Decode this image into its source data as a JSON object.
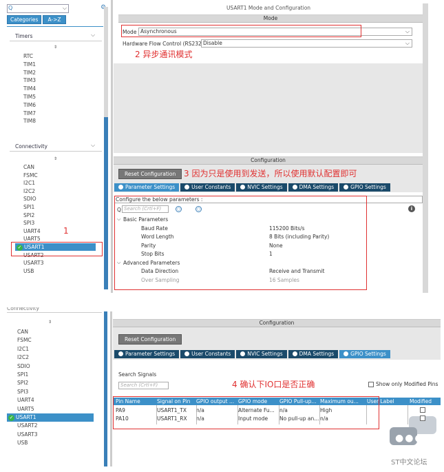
{
  "top": {
    "sidebar": {
      "search_placeholder": "Q",
      "tabs": [
        "Categories",
        "A->Z"
      ],
      "sections": [
        {
          "title": "Timers",
          "items": [
            "RTC",
            "TIM1",
            "TIM2",
            "TIM3",
            "TIM4",
            "TIM5",
            "TIM6",
            "TIM7",
            "TIM8"
          ]
        },
        {
          "title": "Connectivity",
          "items": [
            "CAN",
            "FSMC",
            "I2C1",
            "I2C2",
            "SDIO",
            "SPI1",
            "SPI2",
            "SPI3",
            "UART4",
            "UART5",
            "USART1",
            "USART2",
            "USART3",
            "USB"
          ]
        }
      ],
      "selected": "USART1"
    },
    "window_title": "USART1 Mode and Configuration",
    "mode_header": "Mode",
    "mode_label": "Mode",
    "mode_value": "Asynchronous",
    "hwflow_label": "Hardware Flow Control (RS232)",
    "hwflow_value": "Disable",
    "annotation_2": "2 异步通讯模式",
    "annotation_1": "1",
    "config_header": "Configuration",
    "reset_label": "Reset Configuration",
    "annotation_3": "3 因为只是使用到发送，所以使用默认配置即可",
    "tabs": [
      "Parameter Settings",
      "User Constants",
      "NVIC Settings",
      "DMA Settings",
      "GPIO Settings"
    ],
    "configure_text": "Configure the below parameters :",
    "search_placeholder": "Search (Crtl+F)",
    "groups": [
      {
        "title": "Basic Parameters",
        "rows": [
          {
            "name": "Baud Rate",
            "value": "115200 Bits/s"
          },
          {
            "name": "Word Length",
            "value": "8 Bits (including Parity)"
          },
          {
            "name": "Parity",
            "value": "None"
          },
          {
            "name": "Stop Bits",
            "value": "1"
          }
        ]
      },
      {
        "title": "Advanced Parameters",
        "rows": [
          {
            "name": "Data Direction",
            "value": "Receive and Transmit"
          },
          {
            "name": "Over Sampling",
            "value": "16 Samples"
          }
        ]
      }
    ]
  },
  "bottom": {
    "sidebar_header": "Connectivity",
    "items": [
      "CAN",
      "FSMC",
      "I2C1",
      "I2C2",
      "SDIO",
      "SPI1",
      "SPI2",
      "SPI3",
      "UART4",
      "UART5",
      "USART1",
      "USART2",
      "USART3",
      "USB"
    ],
    "config_header": "Configuration",
    "reset_label": "Reset Configuration",
    "tabs": [
      "Parameter Settings",
      "User Constants",
      "NVIC Settings",
      "DMA Settings",
      "GPIO Settings"
    ],
    "search_signals": "Search Signals",
    "search_placeholder": "Search (Crtl+F)",
    "annotation_4": "4 确认下IO口是否正确",
    "show_modified": "Show only Modified Pins",
    "columns": [
      "Pin Name",
      "Signal on Pin",
      "GPIO output ...",
      "GPIO mode",
      "GPIO Pull-up...",
      "Maximum ou...",
      "User Label",
      "Modified"
    ],
    "rows": [
      [
        "PA9",
        "USART1_TX",
        "n/a",
        "Alternate Fu...",
        "n/a",
        "High",
        "",
        ""
      ],
      [
        "PA10",
        "USART1_RX",
        "n/a",
        "Input mode",
        "No pull-up an...",
        "n/a",
        "",
        ""
      ]
    ]
  },
  "watermark": "ST中文论坛"
}
